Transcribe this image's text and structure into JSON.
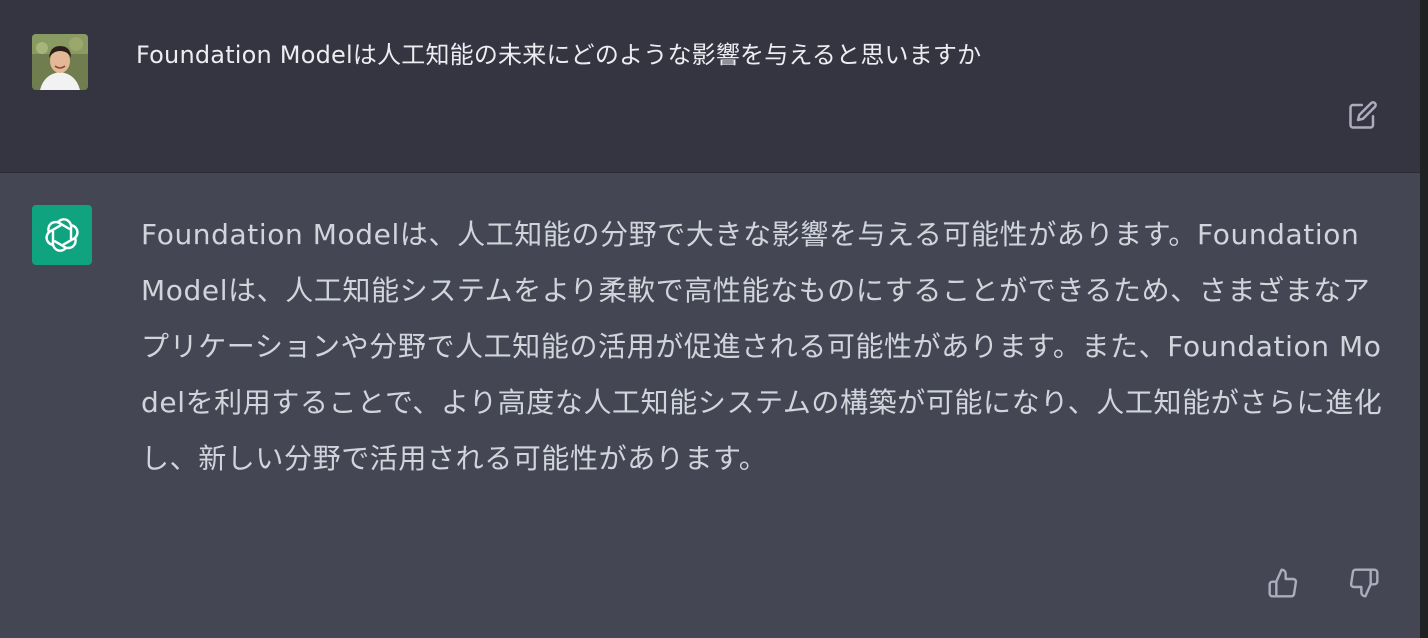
{
  "conversation": {
    "user_message": {
      "avatar": "user-photo-avatar",
      "text": "Foundation Modelは人工知能の未来にどのような影響を与えると思いますか",
      "edit_icon": "pencil-square-icon"
    },
    "assistant_message": {
      "avatar": "openai-logo",
      "brand_color": "#10a37f",
      "text": "Foundation Modelは、人工知能の分野で大きな影響を与える可能性があります。Foundation Modelは、人工知能システムをより柔軟で高性能なものにすることができるため、さまざまなアプリケーションや分野で人工知能の活用が促進される可能性があります。また、Foundation Modelを利用することで、より高度な人工知能システムの構築が可能になり、人工知能がさらに進化し、新しい分野で活用される可能性があります。",
      "feedback": {
        "thumbs_up_icon": "thumbs-up-icon",
        "thumbs_down_icon": "thumbs-down-icon"
      }
    }
  },
  "colors": {
    "user_bg": "#343541",
    "assistant_bg": "#444654",
    "text_primary": "#ececf1",
    "text_answer": "#d1d5db",
    "icon_gray": "#acacbe"
  }
}
